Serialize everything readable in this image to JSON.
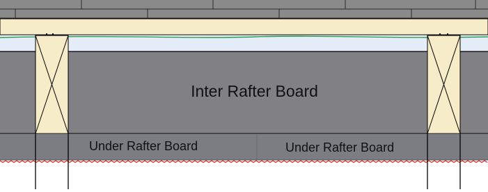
{
  "labels": {
    "inter_rafter": "Inter Rafter Board",
    "under_rafter_left": "Under Rafter Board",
    "under_rafter_right": "Under Rafter Board"
  },
  "colors": {
    "tile": "#8a8a8a",
    "batten": "#f6ecc8",
    "membrane": "#2e9e54",
    "air_gap": "#e4edf8",
    "insulation_board": "#808085",
    "under_board": "#7c7d82",
    "rafter": "#f6ecc8",
    "vapour_layer": "#e02828",
    "outline": "#000000"
  }
}
